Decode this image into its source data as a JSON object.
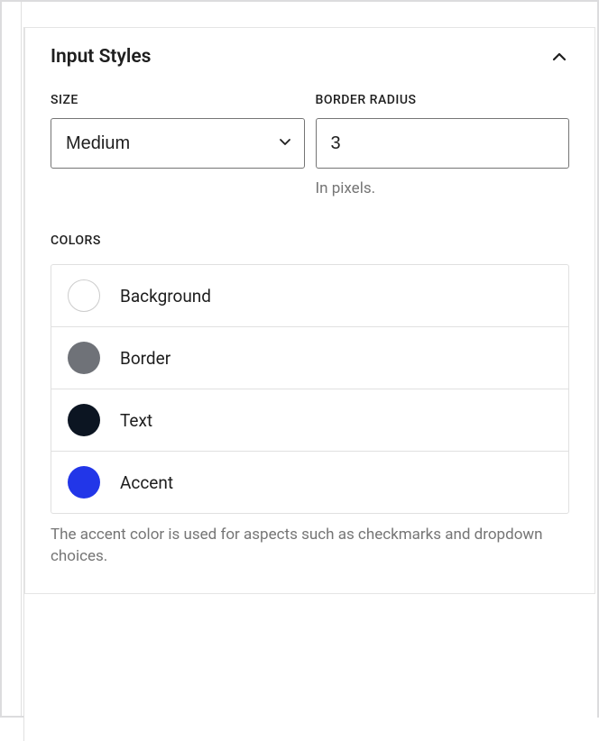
{
  "section": {
    "title": "Input Styles",
    "size_label": "SIZE",
    "size_value": "Medium",
    "border_radius_label": "BORDER RADIUS",
    "border_radius_value": "3",
    "border_radius_help": "In pixels.",
    "colors_label": "COLORS",
    "colors_help": "The accent color is used for aspects such as checkmarks and dropdown choices.",
    "colors": [
      {
        "label": "Background",
        "value": "#ffffff",
        "has_border": true
      },
      {
        "label": "Border",
        "value": "#6f7278",
        "has_border": false
      },
      {
        "label": "Text",
        "value": "#0c1522",
        "has_border": false
      },
      {
        "label": "Accent",
        "value": "#2236e8",
        "has_border": false
      }
    ]
  }
}
